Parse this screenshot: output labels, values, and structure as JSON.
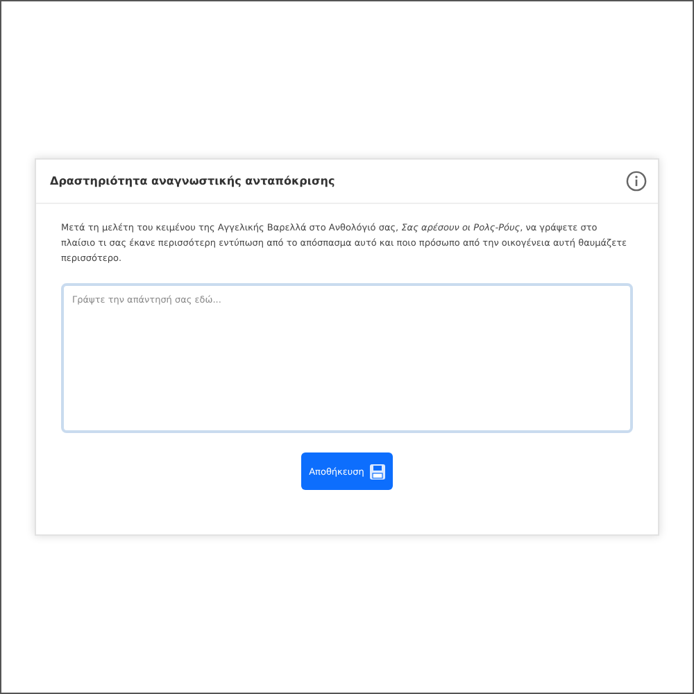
{
  "card": {
    "title": "Δραστηριότητα αναγνωστικής ανταπόκρισης",
    "instructions": "Μετά τη μελέτη του κειμένου της Αγγελικής Βαρελλά στο Ανθολόγιό σας, *Σας αρέσουν οι Ρολς-Ρόυς*, να γράψετε στο πλαίσιο τι σας έκανε περισσότερη εντύπωση από το απόσπασμα αυτό και ποιο πρόσωπο από την οικογένεια αυτή θαυμάζετε περισσότερο.",
    "answer": {
      "placeholder": "Γράψτε την απάντησή σας εδώ..."
    },
    "button": "Αποθήκευση"
  }
}
